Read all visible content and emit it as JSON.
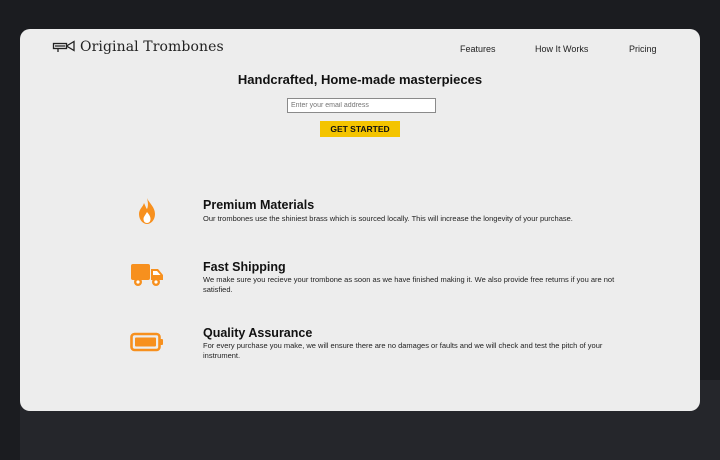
{
  "brand": {
    "name": "Original Trombones",
    "logo_icon": "trombone-icon"
  },
  "nav": {
    "items": [
      {
        "label": "Features"
      },
      {
        "label": "How It Works"
      },
      {
        "label": "Pricing"
      }
    ]
  },
  "hero": {
    "headline": "Handcrafted, Home-made masterpieces",
    "email_placeholder": "Enter your email address",
    "email_value": "",
    "cta_label": "GET STARTED"
  },
  "features": [
    {
      "icon": "flame-icon",
      "title": "Premium Materials",
      "description": "Our trombones use the shiniest brass which is sourced locally. This will increase the longevity of your purchase."
    },
    {
      "icon": "truck-icon",
      "title": "Fast Shipping",
      "description": "We make sure you recieve your trombone as soon as we have finished making it. We also provide free returns if you are not satisfied."
    },
    {
      "icon": "battery-icon",
      "title": "Quality Assurance",
      "description": "For every purchase you make, we will ensure there are no damages or faults and we will check and test the pitch of your instrument."
    }
  ],
  "colors": {
    "accent": "#f4c400",
    "icon": "#f7901e",
    "card_background": "#ededed",
    "page_background": "#1b1c20"
  }
}
